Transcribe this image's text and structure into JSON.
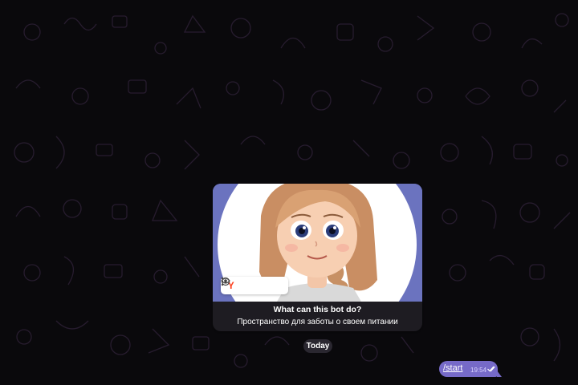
{
  "bot_info": {
    "title": "What can this bot do?",
    "description": "Пространство для заботы о своем питании",
    "image_toolbar": {
      "yandex_label": "Y",
      "buttons": [
        "yandex-icon",
        "eye-icon",
        "camera-search-icon",
        "more-vertical-icon"
      ]
    }
  },
  "date_separator": "Today",
  "messages": [
    {
      "text": "/start",
      "time": "19:54",
      "status": "read",
      "direction": "outgoing"
    }
  ],
  "colors": {
    "background": "#0a090c",
    "card": "#1e1c22",
    "outgoing_bubble": "#766ac8",
    "image_backdrop": "#6b73bf"
  }
}
